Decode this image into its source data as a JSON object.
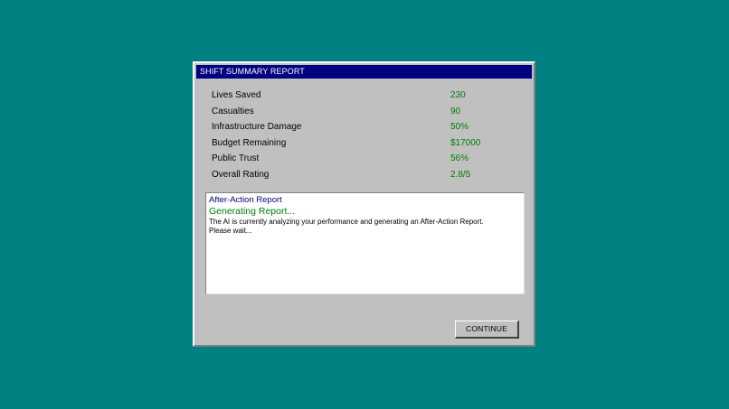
{
  "dialog": {
    "title": "SHIFT SUMMARY REPORT"
  },
  "stats": [
    {
      "label": "Lives Saved",
      "value": "230"
    },
    {
      "label": "Casualties",
      "value": "90"
    },
    {
      "label": "Infrastructure Damage",
      "value": "50%"
    },
    {
      "label": "Budget Remaining",
      "value": "$17000"
    },
    {
      "label": "Public Trust",
      "value": "56%"
    },
    {
      "label": "Overall Rating",
      "value": "2.8/5"
    }
  ],
  "report": {
    "title": "After-Action Report",
    "status": "Generating Report...",
    "body": "The AI is currently analyzing your performance and generating an After-Action Report. Please wait..."
  },
  "buttons": {
    "continue_label": "CONTINUE"
  },
  "colors": {
    "desktop": "#008080",
    "titlebar": "#000080",
    "value_green": "#008000"
  }
}
